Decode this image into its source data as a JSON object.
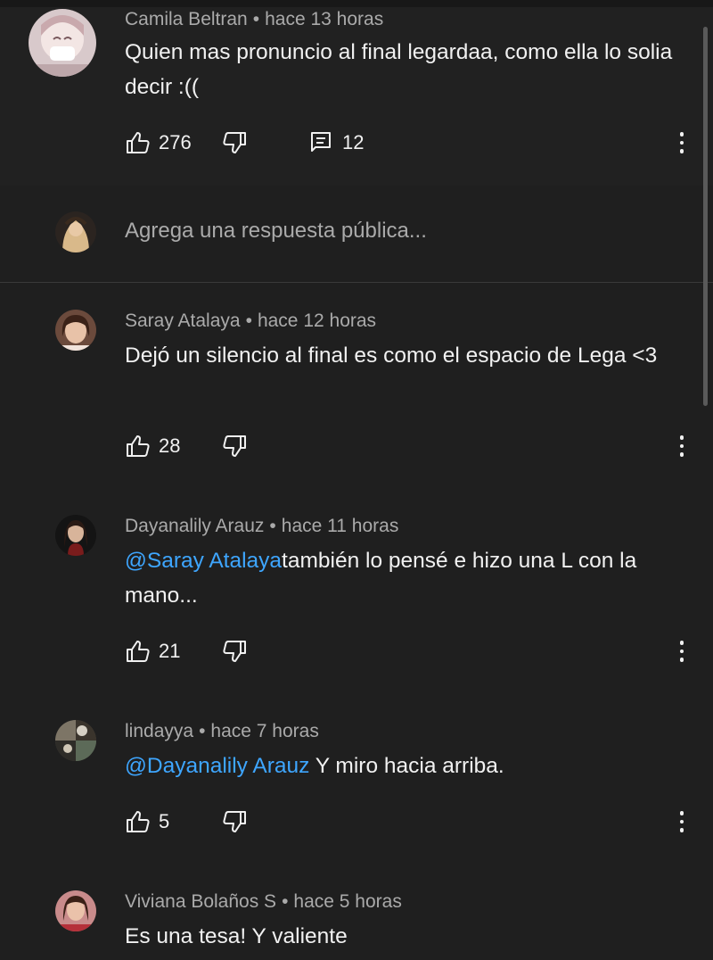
{
  "main_comment": {
    "author": "Camila Beltran",
    "time": "hace 13 horas",
    "text": "Quien mas pronuncio al final legardaa, como ella lo solia decir :((",
    "likes": "276",
    "replies": "12"
  },
  "reply_input": {
    "placeholder": "Agrega una respuesta pública..."
  },
  "replies": [
    {
      "author": "Saray Atalaya",
      "time": "hace 12 horas",
      "mention": "",
      "text": "Dejó un silencio al final es como el espacio de Lega <3",
      "likes": "28"
    },
    {
      "author": "Dayanalily Arauz",
      "time": "hace 11 horas",
      "mention": "@Saray Atalaya",
      "text": "también lo pensé  e hizo una L con la mano...",
      "likes": "21"
    },
    {
      "author": "lindayya",
      "time": "hace 7 horas",
      "mention": "@Dayanalily Arauz",
      "text": " Y miro hacia arriba.",
      "likes": "5"
    },
    {
      "author": "Viviana Bolaños S",
      "time": "hace 5 horas",
      "mention": "",
      "text": "Es una tesa! Y valiente",
      "likes": ""
    }
  ],
  "separator": "•",
  "icons": {
    "like": "thumbs-up-icon",
    "dislike": "thumbs-down-icon",
    "reply": "comment-icon",
    "more": "more-vert-icon"
  },
  "colors": {
    "background": "#1f1f1f",
    "text": "#f1f1f1",
    "secondary_text": "#aaaaaa",
    "mention": "#3ea6ff"
  }
}
